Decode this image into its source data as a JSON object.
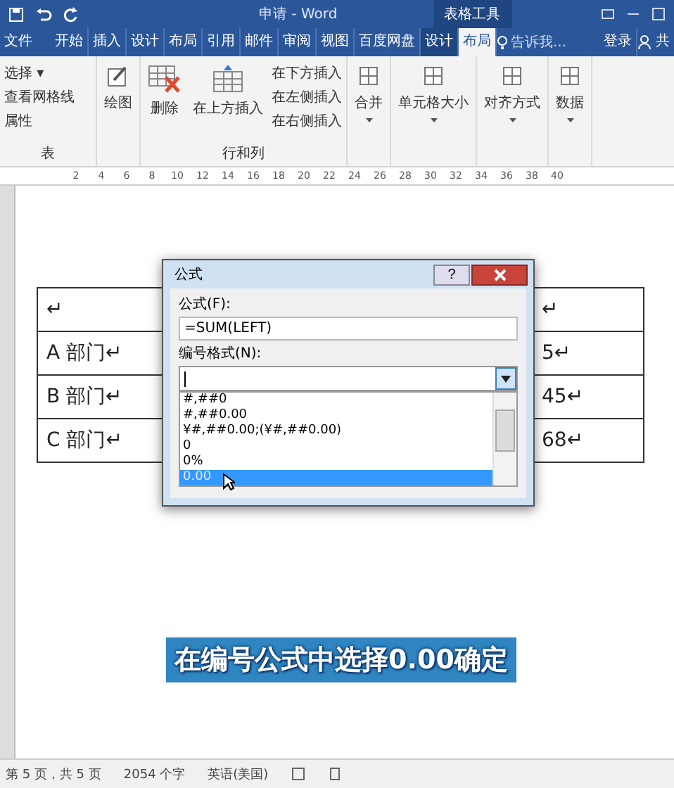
{
  "title_bar": {
    "title": "申请 - Word",
    "context_tab": "表格工具"
  },
  "tabs": [
    {
      "label": "文件",
      "selected": false
    },
    {
      "label": "开始",
      "selected": false
    },
    {
      "label": "插入",
      "selected": false
    },
    {
      "label": "设计",
      "selected": false
    },
    {
      "label": "布局",
      "selected": false
    },
    {
      "label": "引用",
      "selected": false
    },
    {
      "label": "邮件",
      "selected": false
    },
    {
      "label": "审阅",
      "selected": false
    },
    {
      "label": "视图",
      "selected": false
    },
    {
      "label": "百度网盘",
      "selected": false
    },
    {
      "label": "设计",
      "selected": false
    },
    {
      "label": "布局",
      "selected": true
    }
  ],
  "tell_me": "告诉我...",
  "sign_in": "登录",
  "share": "共",
  "ribbon": {
    "table_group": {
      "items": [
        "选择 ▾",
        "查看网格线",
        "属性"
      ],
      "label": "表"
    },
    "draw": "绘图",
    "delete": "删除",
    "insert_above": "在上方插入",
    "insert_small": [
      "在下方插入",
      "在左侧插入",
      "在右侧插入"
    ],
    "rows_cols_label": "行和列",
    "big_buttons": [
      "合并",
      "单元格大小",
      "对齐方式",
      "数据"
    ]
  },
  "ruler": [
    "2",
    "4",
    "6",
    "8",
    "10",
    "12",
    "14",
    "16",
    "18",
    "20",
    "22",
    "24",
    "26",
    "28",
    "30",
    "32",
    "34",
    "36",
    "38",
    "40"
  ],
  "table": {
    "rows": [
      [
        "↵",
        "↵"
      ],
      [
        "A 部门↵",
        "5↵"
      ],
      [
        "B 部门↵",
        "45↵"
      ],
      [
        "C 部门↵",
        "68↵"
      ]
    ]
  },
  "dialog": {
    "title": "公式",
    "help": "?",
    "formula_label": "公式(F):",
    "formula": "=SUM(LEFT)",
    "format_label": "编号格式(N):",
    "options": [
      {
        "label": "#,##0",
        "selected": false
      },
      {
        "label": "#,##0.00",
        "selected": false
      },
      {
        "label": "¥#,##0.00;(¥#,##0.00)",
        "selected": false
      },
      {
        "label": "0",
        "selected": false
      },
      {
        "label": "0%",
        "selected": false
      },
      {
        "label": "0.00",
        "selected": true
      }
    ]
  },
  "caption": "在编号公式中选择0.00确定",
  "status_bar": {
    "page": "第 5 页，共 5 页",
    "words": "2054 个字",
    "language": "英语(美国)"
  }
}
